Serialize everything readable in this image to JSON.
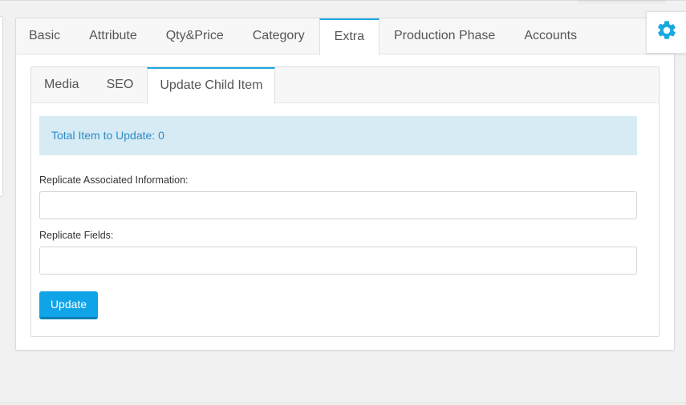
{
  "main_tabs": [
    {
      "label": "Basic"
    },
    {
      "label": "Attribute"
    },
    {
      "label": "Qty&Price"
    },
    {
      "label": "Category"
    },
    {
      "label": "Extra"
    },
    {
      "label": "Production Phase"
    },
    {
      "label": "Accounts"
    }
  ],
  "active_main_tab": "Extra",
  "sub_tabs": [
    {
      "label": "Media"
    },
    {
      "label": "SEO"
    },
    {
      "label": "Update Child Item"
    }
  ],
  "active_sub_tab": "Update Child Item",
  "info": {
    "total_text": "Total Item to Update: 0"
  },
  "form": {
    "associated_label": "Replicate Associated Information:",
    "associated_value": "",
    "fields_label": "Replicate Fields:",
    "fields_value": "",
    "update_label": "Update"
  },
  "icons": {
    "settings": "gear-icon"
  },
  "colors": {
    "accent": "#1ba8e0",
    "button": "#0fa3e8",
    "info_bg": "#d7ebf5",
    "info_text": "#2a8cc7",
    "gear": "#1ba8e0"
  }
}
